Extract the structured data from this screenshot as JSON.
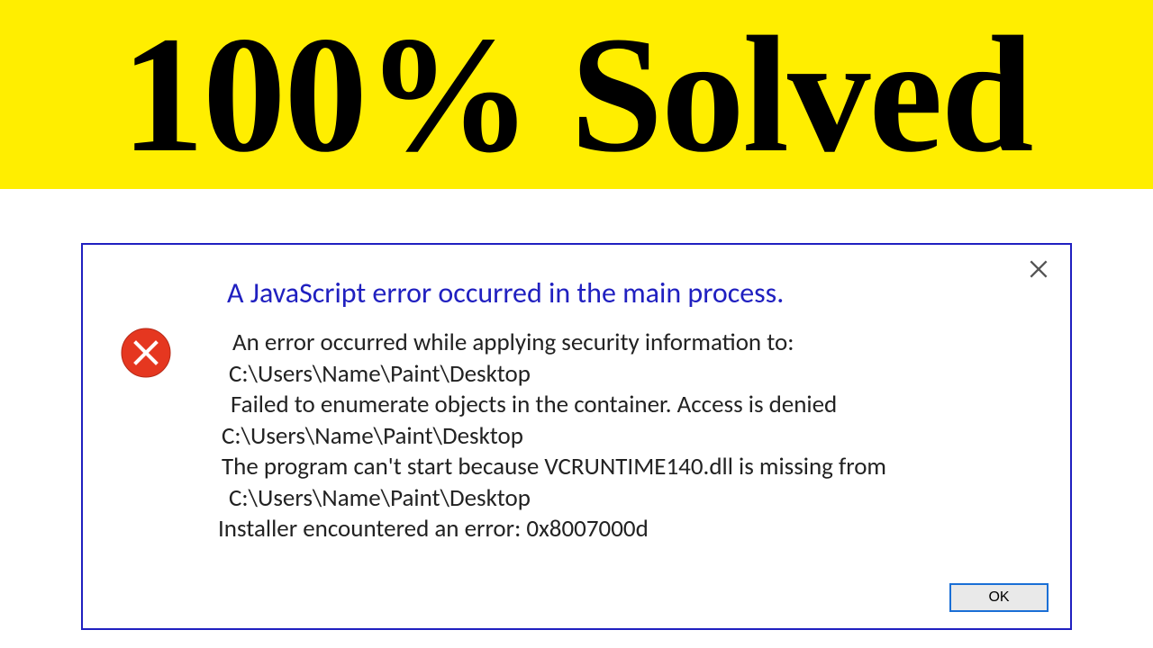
{
  "banner": {
    "text": "100% Solved"
  },
  "dialog": {
    "title": "A JavaScript error occurred in the main process.",
    "lines": {
      "l1": "An error occurred while applying security information to:",
      "l2": "C:\\Users\\Name\\Paint\\Desktop",
      "l3": "Failed to enumerate objects in the container. Access is denied",
      "l4": "C:\\Users\\Name\\Paint\\Desktop",
      "l5": "The program can't start because VCRUNTIME140.dll is missing from",
      "l6": "C:\\Users\\Name\\Paint\\Desktop",
      "l7": "Installer encountered an error: 0x8007000d"
    },
    "ok_label": "OK"
  },
  "colors": {
    "banner_bg": "#ffee00",
    "dialog_border": "#2020c0",
    "title_color": "#2020c0",
    "error_icon_bg": "#e53720",
    "ok_border": "#1a6fd6"
  }
}
